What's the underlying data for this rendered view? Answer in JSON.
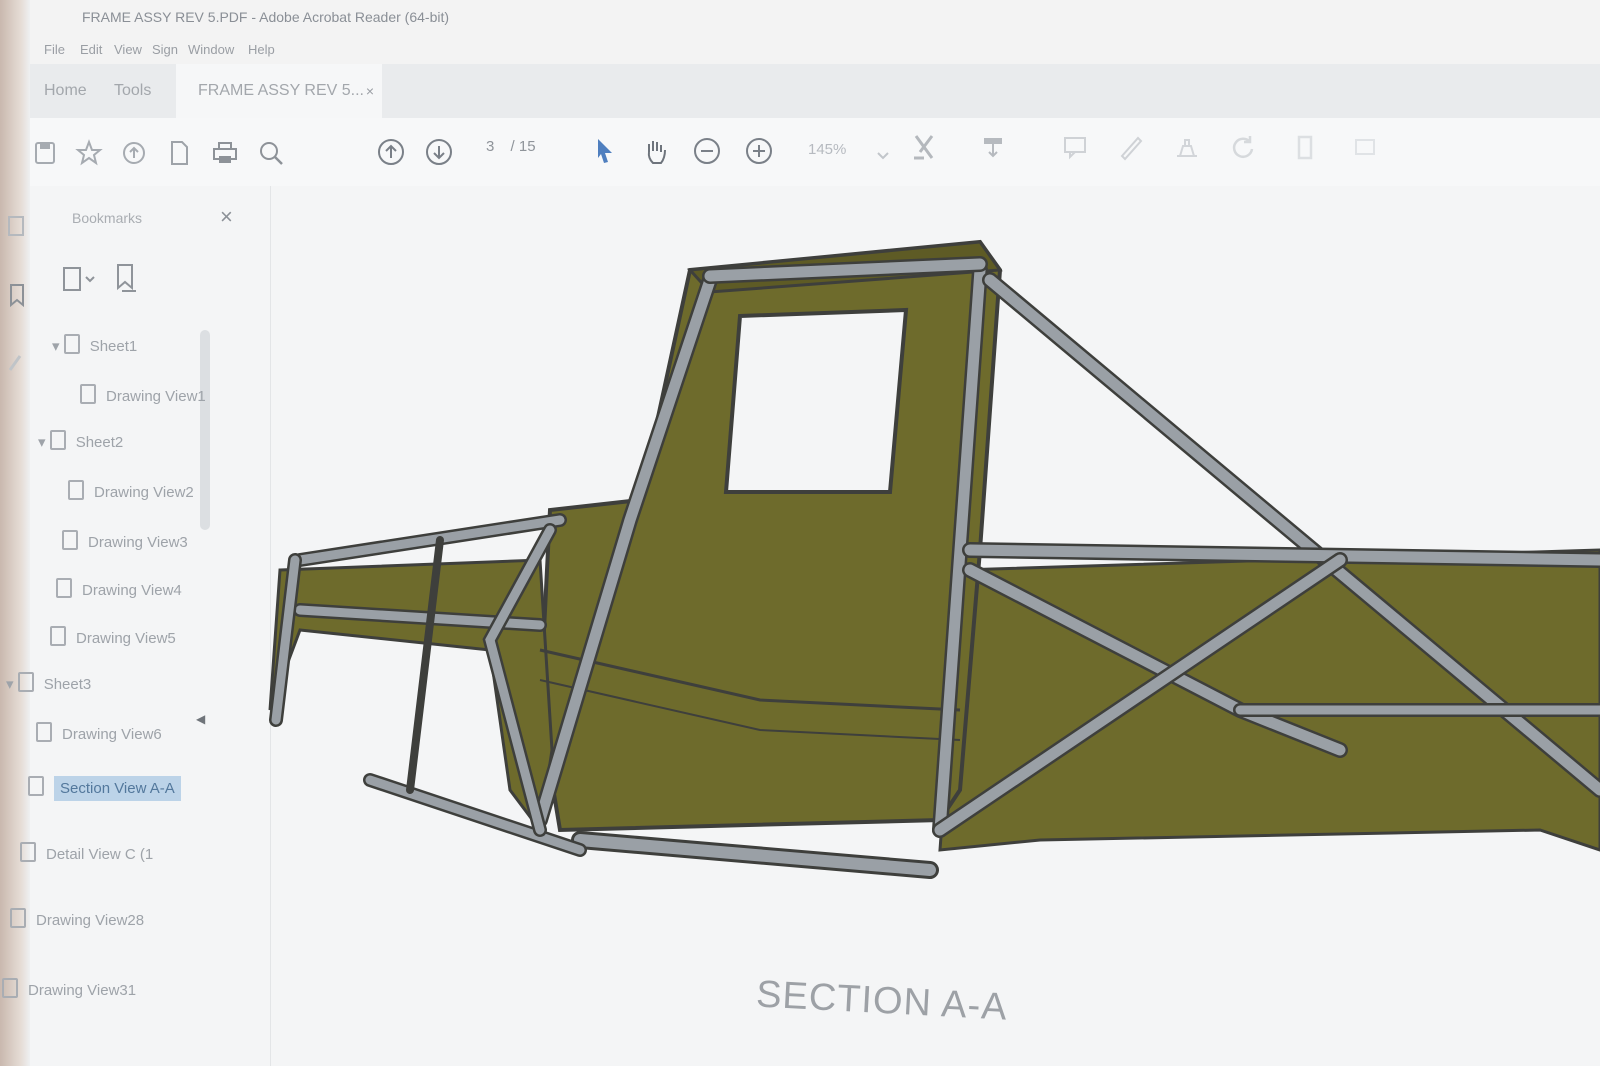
{
  "window": {
    "title": "FRAME ASSY REV 5.PDF - Adobe Acrobat Reader (64-bit)"
  },
  "menu": [
    "File",
    "Edit",
    "View",
    "Sign",
    "Window",
    "Help"
  ],
  "tabs": {
    "home": "Home",
    "tools": "Tools",
    "document": "FRAME ASSY REV 5...",
    "close": "×"
  },
  "toolbar": {
    "page_current": "3",
    "page_total": "/ 15",
    "zoom": "145%",
    "icons": [
      "save-icon",
      "bookmark-star-icon",
      "upload-icon",
      "page-icon",
      "print-icon",
      "search-icon",
      "page-up-icon",
      "page-down-icon",
      "select-arrow-icon",
      "hand-icon",
      "zoom-out-icon",
      "zoom-in-icon"
    ]
  },
  "bookmarks": {
    "title": "Bookmarks",
    "close": "×",
    "items": [
      {
        "label": "Sheet1"
      },
      {
        "label": "Drawing View1"
      },
      {
        "label": "Sheet2"
      },
      {
        "label": "Drawing View2"
      },
      {
        "label": "Drawing View3"
      },
      {
        "label": "Drawing View4"
      },
      {
        "label": "Drawing View5"
      },
      {
        "label": "Sheet3"
      },
      {
        "label": "Drawing View6"
      },
      {
        "label": "Section View A-A"
      },
      {
        "label": "Detail View C (1"
      },
      {
        "label": "Drawing View28"
      },
      {
        "label": "Drawing View31"
      }
    ]
  },
  "document": {
    "section_label": "SECTION A-A",
    "colors": {
      "body": "#6e6b2c",
      "tube": "#9aa0a6",
      "outline": "#3e3f3c"
    }
  }
}
